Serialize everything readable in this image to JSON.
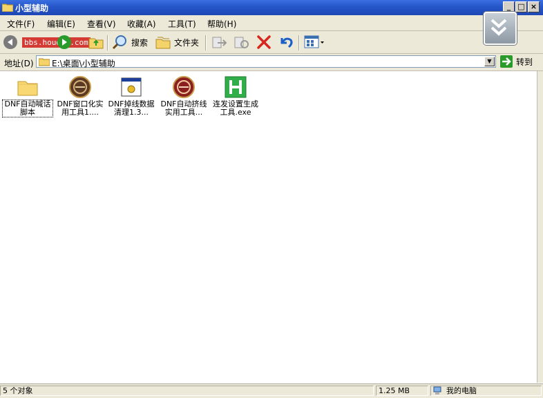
{
  "window": {
    "title": "小型辅助"
  },
  "menu": {
    "items": [
      {
        "label": "文件(F)"
      },
      {
        "label": "编辑(E)"
      },
      {
        "label": "查看(V)"
      },
      {
        "label": "收藏(A)"
      },
      {
        "label": "工具(T)"
      },
      {
        "label": "帮助(H)"
      }
    ]
  },
  "toolbar": {
    "watermark": "bbs.houdao.com",
    "search_label": "搜索",
    "folders_label": "文件夹"
  },
  "address": {
    "label": "地址(D)",
    "path": "E:\\桌面\\小型辅助",
    "go_label": "转到"
  },
  "files": [
    {
      "name": "DNF自动喊话脚本",
      "icon": "folder-icon"
    },
    {
      "name": "DNF窗口化实用工具1....",
      "icon": "dnf-app-icon"
    },
    {
      "name": "DNF掉线数据清理1.3...",
      "icon": "window-app-icon"
    },
    {
      "name": "DNF自动挤线实用工具...",
      "icon": "dnf-app-icon"
    },
    {
      "name": "连发设置生成工具.exe",
      "icon": "h-app-icon"
    }
  ],
  "status": {
    "count": "5 个对象",
    "size": "1.25 MB",
    "location": "我的电脑"
  },
  "colors": {
    "titlebar": "#2556c8",
    "chrome": "#ece9d8"
  }
}
